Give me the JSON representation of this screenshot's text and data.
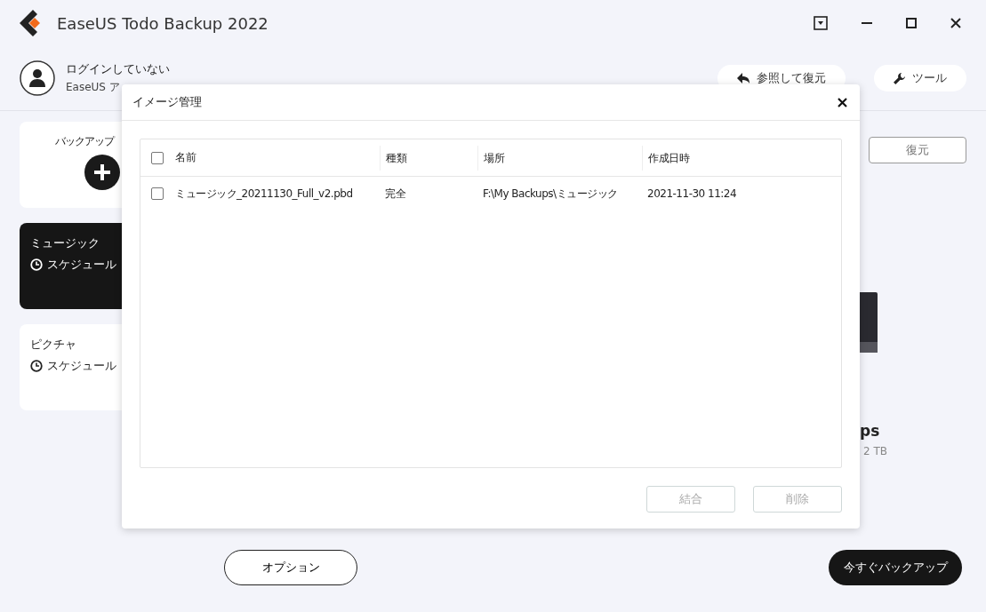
{
  "window": {
    "title": "EaseUS Todo Backup 2022"
  },
  "account": {
    "status": "ログインしていない",
    "subtitle": "EaseUS ア"
  },
  "header_buttons": [
    {
      "kind": "browse",
      "label": "参照して復元"
    },
    {
      "kind": "tools",
      "label": "ツール"
    }
  ],
  "backup_tasks": [
    {
      "kind": "new",
      "title": "バックアップ"
    },
    {
      "kind": "task",
      "title": "ミュージック",
      "schedule": "スケジュール",
      "selected": true
    },
    {
      "kind": "task",
      "title": "ピクチャ",
      "schedule": "スケジュール",
      "selected": false
    }
  ],
  "restore_button": "復元",
  "destination": {
    "name": "ps",
    "size": "2 TB"
  },
  "options_button": "オプション",
  "backup_now_button": "今すぐバックアップ",
  "dialog": {
    "title": "イメージ管理",
    "select_all_checked": false,
    "columns": [
      "名前",
      "種類",
      "場所",
      "作成日時"
    ],
    "rows": [
      {
        "checked": false,
        "cells": [
          "ミュージック_20211130_Full_v2.pbd",
          "完全",
          "F:\\My Backups\\ミュージック",
          "2021-11-30 11:24"
        ]
      }
    ],
    "buttons": [
      {
        "label": "結合",
        "disabled": true
      },
      {
        "label": "削除",
        "disabled": true
      }
    ]
  }
}
